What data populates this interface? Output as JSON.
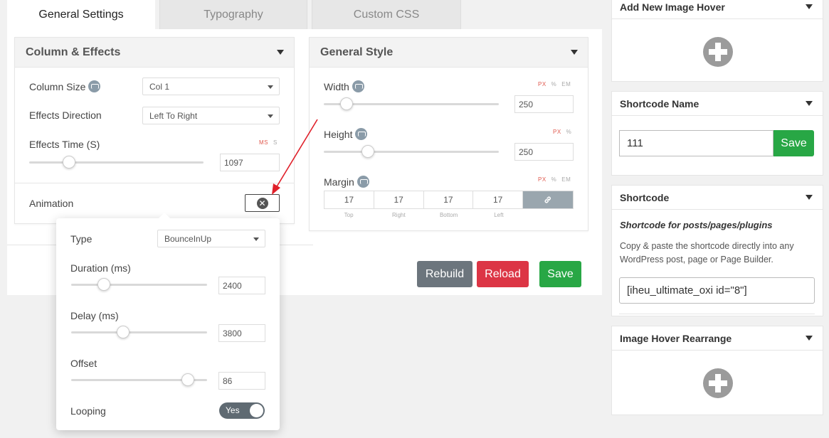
{
  "tabs": [
    "General Settings",
    "Typography",
    "Custom CSS"
  ],
  "column_effects": {
    "title": "Column & Effects",
    "column_size": {
      "label": "Column Size",
      "value": "Col 1"
    },
    "effects_direction": {
      "label": "Effects Direction",
      "value": "Left To Right"
    },
    "effects_time": {
      "label": "Effects Time (S)",
      "units": [
        "MS",
        "S"
      ],
      "value": "1097",
      "slider_fraction": 0.23
    },
    "animation": {
      "label": "Animation"
    }
  },
  "general_style": {
    "title": "General Style",
    "width": {
      "label": "Width",
      "units": [
        "PX",
        "%",
        "EM"
      ],
      "value": "250",
      "slider_fraction": 0.13
    },
    "height": {
      "label": "Height",
      "units": [
        "PX",
        "%"
      ],
      "value": "250",
      "slider_fraction": 0.25
    },
    "margin": {
      "label": "Margin",
      "units": [
        "PX",
        "%",
        "EM"
      ],
      "values": [
        "17",
        "17",
        "17",
        "17"
      ],
      "captions": [
        "Top",
        "Right",
        "Bottom",
        "Left"
      ]
    }
  },
  "actions": {
    "rebuild": "Rebuild",
    "reload": "Reload",
    "save": "Save"
  },
  "animation_popup": {
    "type": {
      "label": "Type",
      "value": "BounceInUp"
    },
    "duration": {
      "label": "Duration (ms)",
      "value": "2400",
      "slider_fraction": 0.24
    },
    "delay": {
      "label": "Delay (ms)",
      "value": "3800",
      "slider_fraction": 0.38
    },
    "offset": {
      "label": "Offset",
      "value": "86",
      "slider_fraction": 0.86
    },
    "looping": {
      "label": "Looping",
      "value": "Yes"
    }
  },
  "sidebar": {
    "add_new": {
      "title": "Add New Image Hover"
    },
    "shortcode_name": {
      "title": "Shortcode Name",
      "value": "111",
      "save_label": "Save"
    },
    "shortcode": {
      "title": "Shortcode",
      "subtitle": "Shortcode for posts/pages/plugins",
      "description": "Copy & paste the shortcode directly into any WordPress post, page or Page Builder.",
      "code": "[iheu_ultimate_oxi id=\"8\"]"
    },
    "rearrange": {
      "title": "Image Hover Rearrange"
    }
  },
  "colors": {
    "rebuild": "#6c757d",
    "reload": "#dc3545",
    "save": "#28a745",
    "unit_active": "#e05a4f"
  }
}
